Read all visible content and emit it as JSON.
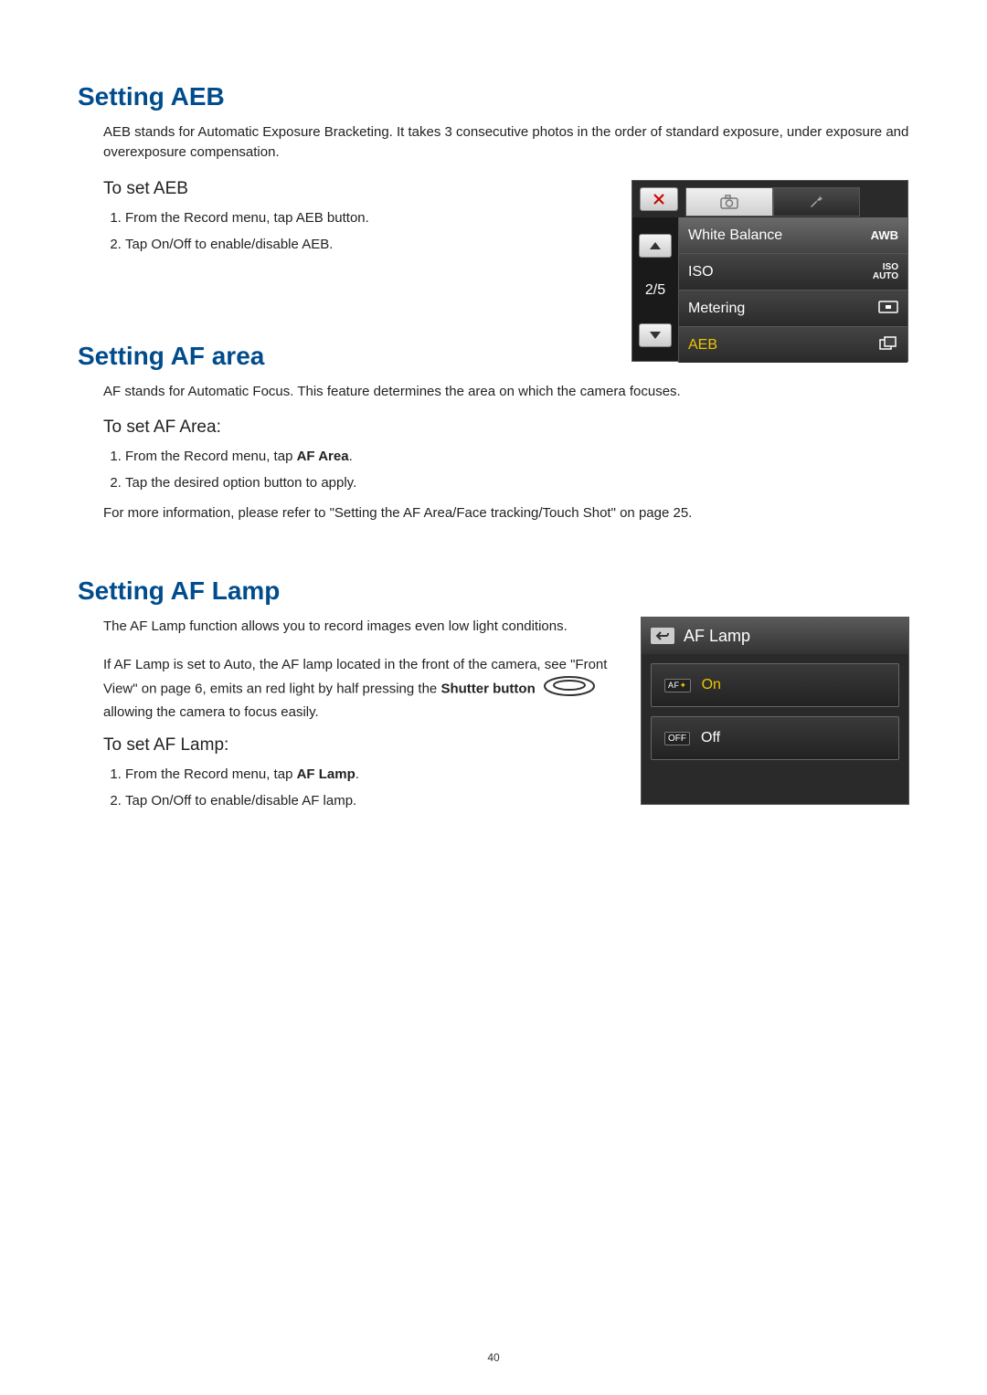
{
  "page_number": "40",
  "sections": {
    "aeb": {
      "title": "Setting AEB",
      "intro": "AEB stands for Automatic Exposure Bracketing.  It takes 3 consecutive photos in the order of standard exposure, under exposure and overexposure compensation.",
      "sub": "To set AEB",
      "steps": [
        "From the Record menu, tap AEB button.",
        "Tap On/Off to enable/disable AEB."
      ],
      "menu": {
        "page": "2/5",
        "rows": [
          {
            "label": "White Balance",
            "value": "AWB"
          },
          {
            "label": "ISO",
            "value": "ISO AUTO"
          },
          {
            "label": "Metering",
            "value": "[■]"
          },
          {
            "label": "AEB",
            "value": ""
          }
        ]
      }
    },
    "afarea": {
      "title": "Setting AF area",
      "intro": "AF stands for Automatic Focus.  This feature determines the area on which the camera focuses.",
      "sub": "To set AF Area:",
      "steps_a": "From the Record menu, tap ",
      "steps_a_bold": "AF Area",
      "steps_a_end": ".",
      "steps_b": "Tap the desired option button to apply.",
      "note": "For more information, please refer to \"Setting the AF Area/Face tracking/Touch Shot\" on page 25."
    },
    "aflamp": {
      "title": "Setting AF Lamp",
      "intro": "The AF Lamp function allows you to record images even low light conditions.",
      "para_a": "If AF Lamp is set to Auto, the AF lamp located in the front of the camera, see \"Front View\" on page 6, emits an red light by half pressing the ",
      "para_a_bold": "Shutter button",
      "para_a_end": " allowing the camera to focus easily.",
      "sub": "To set AF Lamp:",
      "steps_a": "From the Record menu, tap ",
      "steps_a_bold": "AF Lamp",
      "steps_a_end": ".",
      "steps_b": "Tap On/Off to enable/disable AF lamp.",
      "screen": {
        "title": "AF Lamp",
        "options": [
          {
            "badge": "AF",
            "label": "On"
          },
          {
            "badge": "OFF",
            "label": "Off"
          }
        ]
      }
    }
  }
}
